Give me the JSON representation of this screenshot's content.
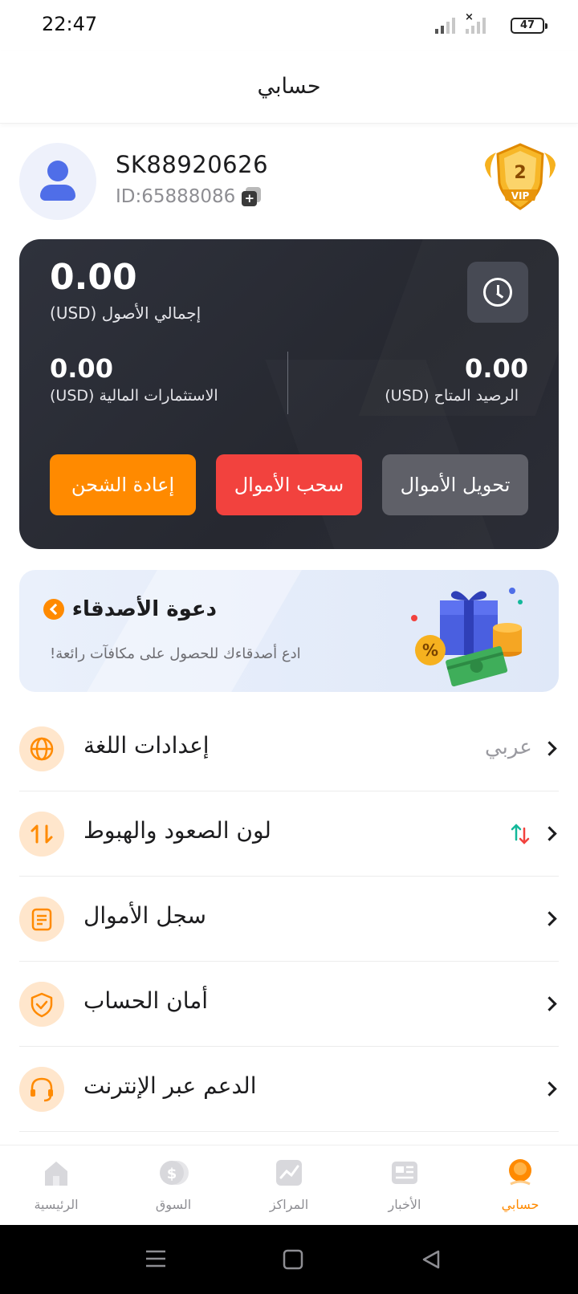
{
  "status_bar": {
    "time": "22:47",
    "battery": "47"
  },
  "header": {
    "title": "حسابي"
  },
  "profile": {
    "username": "SK88920626",
    "user_id": "ID:65888086",
    "vip_level": "2",
    "vip_label": "VIP"
  },
  "assets": {
    "total_value": "0.00",
    "total_label": "إجمالي الأصول   (USD)",
    "investments_value": "0.00",
    "investments_label": "الاستثمارات المالية   (USD)",
    "available_value": "0.00",
    "available_label": "الرصيد المتاح   (USD)",
    "recharge_label": "إعادة الشحن",
    "withdraw_label": "سحب الأموال",
    "transfer_label": "تحويل الأموال"
  },
  "invite": {
    "title": "دعوة الأصدقاء",
    "subtitle": "ادع أصدقاءك للحصول على مكافآت رائعة!",
    "percent_glyph": "%"
  },
  "menu": {
    "language_label": "إعدادات اللغة",
    "language_value": "عربي",
    "color_label": "لون الصعود والهبوط",
    "fund_history_label": "سجل الأموال",
    "security_label": "أمان الحساب",
    "support_label": "الدعم عبر الإنترنت"
  },
  "bottom_nav": {
    "home": "الرئيسية",
    "market": "السوق",
    "positions": "المراكز",
    "news": "الأخبار",
    "account": "حسابي"
  },
  "colors": {
    "accent": "#ff8a00",
    "withdraw": "#f2423e",
    "transfer": "#5f6068",
    "card_bg": "#2a2c35",
    "up": "#13b89a",
    "down": "#f2423e"
  },
  "icons": {
    "language": "globe-icon",
    "color": "up-down-arrows-icon",
    "fund_history": "document-icon",
    "security": "shield-check-icon",
    "support": "headset-icon"
  }
}
